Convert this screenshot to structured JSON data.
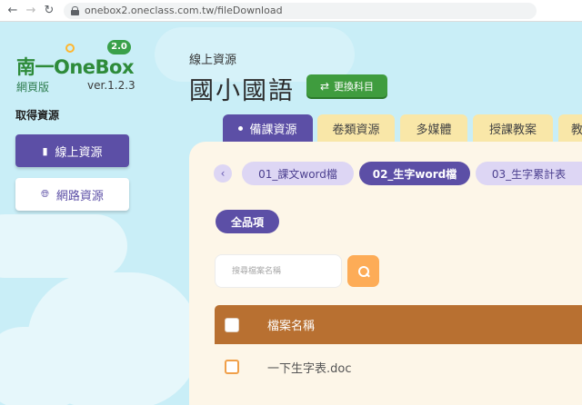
{
  "browser": {
    "url": "onebox2.oneclass.com.tw/fileDownload"
  },
  "sidebar": {
    "logo_text": "南一OneBox",
    "logo_badge": "2.0",
    "subtitle": "網頁版",
    "version": "ver.1.2.3",
    "section_title": "取得資源",
    "items": [
      {
        "label": "線上資源",
        "icon": "document-icon",
        "active": true
      },
      {
        "label": "網路資源",
        "icon": "globe-icon",
        "active": false
      }
    ]
  },
  "header": {
    "breadcrumb": "線上資源",
    "title": "國小國語",
    "change_subject_label": "更換科目"
  },
  "tabs": [
    {
      "label": "備課資源",
      "active": true
    },
    {
      "label": "卷類資源",
      "active": false
    },
    {
      "label": "多媒體",
      "active": false
    },
    {
      "label": "授課教案",
      "active": false
    },
    {
      "label": "教",
      "active": false
    }
  ],
  "folders": [
    {
      "label": "01_課文word檔",
      "active": false
    },
    {
      "label": "02_生字word檔",
      "active": true
    },
    {
      "label": "03_生字累計表",
      "active": false
    }
  ],
  "filter": {
    "all_label": "全品項"
  },
  "search": {
    "placeholder": "搜尋檔案名稱"
  },
  "table": {
    "header": "檔案名稱",
    "rows": [
      {
        "name": "一下生字表.doc"
      }
    ]
  },
  "colors": {
    "purple": "#5c4fa6",
    "green": "#3f9c3e",
    "tab_inactive": "#f9e7a8",
    "table_header": "#b87031",
    "search_button": "#fdac57"
  }
}
